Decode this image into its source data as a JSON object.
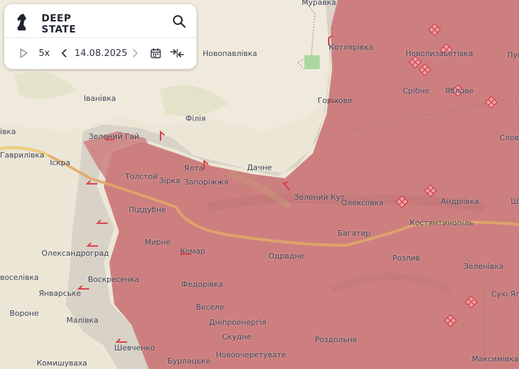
{
  "app": {
    "logo_line1": "DEEP",
    "logo_line2": "STATE",
    "speed": "5x",
    "date": "14.08.2025"
  },
  "icons": {
    "logo": "chess-knight-icon",
    "search": "search-icon",
    "play": "play-icon",
    "prev": "chevron-left-icon",
    "next": "chevron-right-icon",
    "calendar": "calendar-icon",
    "compare": "compare-arrows-icon"
  },
  "colors": {
    "occupied": "#cd7f7f",
    "contested": "#d9d2c7",
    "terrain": "#ece6d6",
    "road": "#e0a76a",
    "attack_marker": "#d9404a"
  },
  "places": {
    "muravka": "Муравка",
    "kotliarivka": "Котлярівка",
    "novolyzavetivka": "Новолизаветівка",
    "pus": "Пус",
    "novopavlivka": "Новопавлівка",
    "ivanivka": "Іванівка",
    "sribne": "Срібне",
    "yalta_east": "Яблове",
    "horikhove": "Горіхове",
    "filiia": "Філія",
    "ivka_left": "івка",
    "zelenyi_hai": "Зелений Гай",
    "slov": "Слов",
    "havrylivka": "Гаврилівка",
    "iskra": "Іскра",
    "yalta": "Ялта",
    "dachne": "Дачне",
    "tolstoi": "Толстой",
    "zirka": "Зірка",
    "zaporizhzhia": "Запоріжжя",
    "zelenyi_kut": "Зелений Кут",
    "oleksiivka": "Олексіївка",
    "andriivka": "Андріївка",
    "shch": "Ш",
    "piddubne": "Піддубне",
    "kostiantynopil": "Костянтинопіль",
    "mirne": "Мирне",
    "bahatyr": "Багатир",
    "komar": "Комар",
    "oleksandrograd": "Олександроград",
    "odradne": "Одрадне",
    "rozlyv": "Розлив",
    "zelenivka": "Зеленівка",
    "voselivka": "воселівка",
    "voskresenka": "Воскресенка",
    "fedorivka": "Федорівка",
    "sukhi_yaly": "Сухі Яли",
    "yanvarske": "Январське",
    "vesele": "Веселе",
    "vorone": "Вороне",
    "malivka": "Малівка",
    "dniproenerhiia": "Дніпроенергія",
    "skudne": "Скудне",
    "rozdolne": "Роздольне",
    "shevchenko": "Шевченко",
    "komyshuvakha": "Комишуваха",
    "burlatske": "Бурлацьке",
    "novocheretuvate": "Новоочеретувате",
    "maksymivka": "Максимівка"
  }
}
